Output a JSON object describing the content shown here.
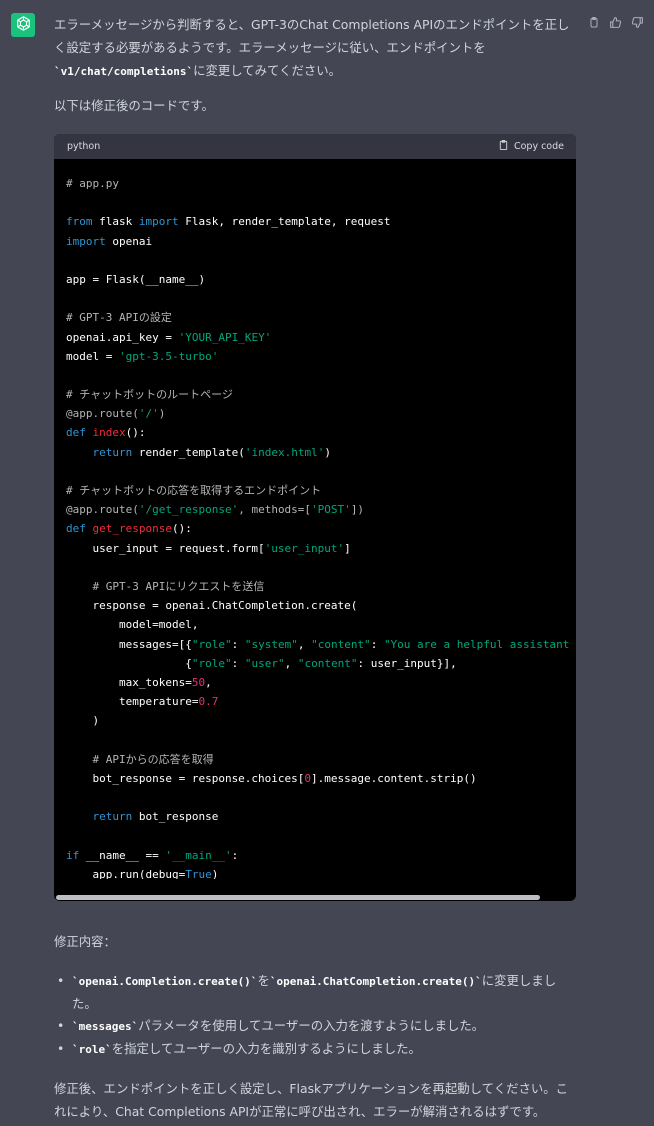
{
  "message": {
    "intro": [
      {
        "t": "エラーメッセージから判断すると、GPT-3のChat Completions APIのエンドポイントを正しく設定する必要があるようです。エラーメッセージに従い、エンドポイントを"
      },
      {
        "t": "`v1/chat/completions`",
        "code": true
      },
      {
        "t": "に変更してみてください。"
      }
    ],
    "code_intro": "以下は修正後のコードです。",
    "code_block": {
      "language": "python",
      "copy_label": "Copy code",
      "lines": [
        [
          {
            "t": "# app.py",
            "c": "comment"
          }
        ],
        [],
        [
          {
            "t": "from",
            "c": "keyword"
          },
          {
            "t": " flask ",
            "c": "plain"
          },
          {
            "t": "import",
            "c": "keyword"
          },
          {
            "t": " Flask, render_template, request",
            "c": "plain"
          }
        ],
        [
          {
            "t": "import",
            "c": "keyword"
          },
          {
            "t": " openai",
            "c": "plain"
          }
        ],
        [],
        [
          {
            "t": "app = Flask(__name__)",
            "c": "plain"
          }
        ],
        [],
        [
          {
            "t": "# GPT-3 APIの設定",
            "c": "comment"
          }
        ],
        [
          {
            "t": "openai.api_key = ",
            "c": "plain"
          },
          {
            "t": "'YOUR_API_KEY'",
            "c": "string"
          }
        ],
        [
          {
            "t": "model = ",
            "c": "plain"
          },
          {
            "t": "'gpt-3.5-turbo'",
            "c": "string"
          }
        ],
        [],
        [
          {
            "t": "# チャットボットのルートページ",
            "c": "comment"
          }
        ],
        [
          {
            "t": "@app.route(",
            "c": "comment"
          },
          {
            "t": "'/'",
            "c": "string"
          },
          {
            "t": ")",
            "c": "comment"
          }
        ],
        [
          {
            "t": "def",
            "c": "keyword"
          },
          {
            "t": " ",
            "c": "plain"
          },
          {
            "t": "index",
            "c": "func"
          },
          {
            "t": "():",
            "c": "plain"
          }
        ],
        [
          {
            "t": "    ",
            "c": "plain"
          },
          {
            "t": "return",
            "c": "keyword"
          },
          {
            "t": " render_template(",
            "c": "plain"
          },
          {
            "t": "'index.html'",
            "c": "string"
          },
          {
            "t": ")",
            "c": "plain"
          }
        ],
        [],
        [
          {
            "t": "# チャットボットの応答を取得するエンドポイント",
            "c": "comment"
          }
        ],
        [
          {
            "t": "@app.route(",
            "c": "comment"
          },
          {
            "t": "'/get_response'",
            "c": "string"
          },
          {
            "t": ", methods=[",
            "c": "comment"
          },
          {
            "t": "'POST'",
            "c": "string"
          },
          {
            "t": "])",
            "c": "comment"
          }
        ],
        [
          {
            "t": "def",
            "c": "keyword"
          },
          {
            "t": " ",
            "c": "plain"
          },
          {
            "t": "get_response",
            "c": "func"
          },
          {
            "t": "():",
            "c": "plain"
          }
        ],
        [
          {
            "t": "    user_input = request.form[",
            "c": "plain"
          },
          {
            "t": "'user_input'",
            "c": "string"
          },
          {
            "t": "]",
            "c": "plain"
          }
        ],
        [],
        [
          {
            "t": "    ",
            "c": "plain"
          },
          {
            "t": "# GPT-3 APIにリクエストを送信",
            "c": "comment"
          }
        ],
        [
          {
            "t": "    response = openai.ChatCompletion.create(",
            "c": "plain"
          }
        ],
        [
          {
            "t": "        model=model,",
            "c": "plain"
          }
        ],
        [
          {
            "t": "        messages=[{",
            "c": "plain"
          },
          {
            "t": "\"role\"",
            "c": "string"
          },
          {
            "t": ": ",
            "c": "plain"
          },
          {
            "t": "\"system\"",
            "c": "string"
          },
          {
            "t": ", ",
            "c": "plain"
          },
          {
            "t": "\"content\"",
            "c": "string"
          },
          {
            "t": ": ",
            "c": "plain"
          },
          {
            "t": "\"You are a helpful assistant",
            "c": "string"
          }
        ],
        [
          {
            "t": "                  {",
            "c": "plain"
          },
          {
            "t": "\"role\"",
            "c": "string"
          },
          {
            "t": ": ",
            "c": "plain"
          },
          {
            "t": "\"user\"",
            "c": "string"
          },
          {
            "t": ", ",
            "c": "plain"
          },
          {
            "t": "\"content\"",
            "c": "string"
          },
          {
            "t": ": user_input}],",
            "c": "plain"
          }
        ],
        [
          {
            "t": "        max_tokens=",
            "c": "plain"
          },
          {
            "t": "50",
            "c": "number"
          },
          {
            "t": ",",
            "c": "plain"
          }
        ],
        [
          {
            "t": "        temperature=",
            "c": "plain"
          },
          {
            "t": "0.7",
            "c": "number"
          }
        ],
        [
          {
            "t": "    )",
            "c": "plain"
          }
        ],
        [],
        [
          {
            "t": "    ",
            "c": "plain"
          },
          {
            "t": "# APIからの応答を取得",
            "c": "comment"
          }
        ],
        [
          {
            "t": "    bot_response = response.choices[",
            "c": "plain"
          },
          {
            "t": "0",
            "c": "number"
          },
          {
            "t": "].message.content.strip()",
            "c": "plain"
          }
        ],
        [],
        [
          {
            "t": "    ",
            "c": "plain"
          },
          {
            "t": "return",
            "c": "keyword"
          },
          {
            "t": " bot_response",
            "c": "plain"
          }
        ],
        [],
        [
          {
            "t": "if",
            "c": "keyword"
          },
          {
            "t": " __name__ == ",
            "c": "plain"
          },
          {
            "t": "'__main__'",
            "c": "string"
          },
          {
            "t": ":",
            "c": "plain"
          }
        ],
        [
          {
            "t": "    app.run(debug=",
            "c": "plain"
          },
          {
            "t": "True",
            "c": "keyword"
          },
          {
            "t": ")",
            "c": "plain"
          }
        ]
      ]
    },
    "changes_heading": "修正内容：",
    "changes": [
      [
        {
          "t": "`openai.Completion.create()`",
          "code": true
        },
        {
          "t": "を"
        },
        {
          "t": "`openai.ChatCompletion.create()`",
          "code": true
        },
        {
          "t": "に変更しました。"
        }
      ],
      [
        {
          "t": "`messages`",
          "code": true
        },
        {
          "t": "パラメータを使用してユーザーの入力を渡すようにしました。"
        }
      ],
      [
        {
          "t": "`role`",
          "code": true
        },
        {
          "t": "を指定してユーザーの入力を識別するようにしました。"
        }
      ]
    ],
    "outro": "修正後、エンドポイントを正しく設定し、Flaskアプリケーションを再起動してください。これにより、Chat Completions APIが正常に呼び出され、エラーが解消されるはずです。"
  },
  "icons": {
    "avatar": "openai-logo-icon",
    "copy": "clipboard-icon",
    "like": "thumbs-up-icon",
    "dislike": "thumbs-down-icon"
  },
  "colors": {
    "background": "#444654",
    "text": "#d1d5db",
    "avatar_bg": "#19c37d",
    "code_bg": "#000000",
    "code_header_bg": "#343541",
    "comment": "#b4b4b4",
    "keyword": "#2e95d3",
    "string": "#00a67d",
    "number": "#df3079",
    "function": "#f22c3d"
  }
}
